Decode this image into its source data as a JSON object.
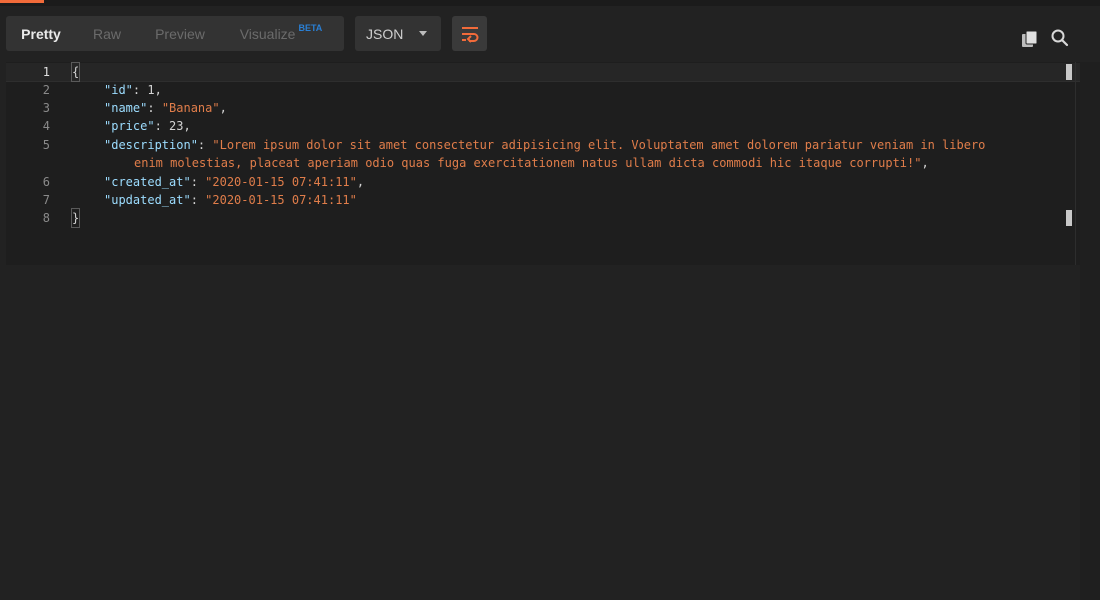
{
  "toolbar": {
    "view_tabs": [
      {
        "label": "Pretty",
        "active": true
      },
      {
        "label": "Raw",
        "active": false
      },
      {
        "label": "Preview",
        "active": false
      },
      {
        "label": "Visualize",
        "active": false
      }
    ],
    "beta_badge": "BETA",
    "format_select": "JSON",
    "icons": [
      "wrap-lines-icon",
      "copy-icon",
      "search-icon"
    ]
  },
  "editor": {
    "line_numbers": [
      "1",
      "2",
      "3",
      "4",
      "5",
      "",
      "6",
      "7",
      "8"
    ],
    "lines": {
      "l1": {
        "brace": "{"
      },
      "l2": {
        "key": "\"id\"",
        "sep": ": ",
        "value": "1",
        "end": ","
      },
      "l3": {
        "key": "\"name\"",
        "sep": ": ",
        "value": "\"Banana\"",
        "end": ","
      },
      "l4": {
        "key": "\"price\"",
        "sep": ": ",
        "value": "23",
        "end": ","
      },
      "l5": {
        "key": "\"description\"",
        "sep": ": ",
        "value": "\"Lorem ipsum dolor sit amet consectetur adipisicing elit. Voluptatem amet dolorem pariatur veniam in libero",
        "cont": "enim molestias, placeat aperiam odio quas fuga exercitationem natus ullam dicta commodi hic itaque corrupti!\"",
        "end": ","
      },
      "l6": {
        "key": "\"created_at\"",
        "sep": ": ",
        "value": "\"2020-01-15 07:41:11\"",
        "end": ","
      },
      "l7": {
        "key": "\"updated_at\"",
        "sep": ": ",
        "value": "\"2020-01-15 07:41:11\""
      },
      "l8": {
        "brace": "}"
      }
    }
  },
  "colors": {
    "accent": "#f26b3a",
    "json_key": "#9cdcfe",
    "json_string": "#e07d4a",
    "beta": "#2a7fd4"
  }
}
